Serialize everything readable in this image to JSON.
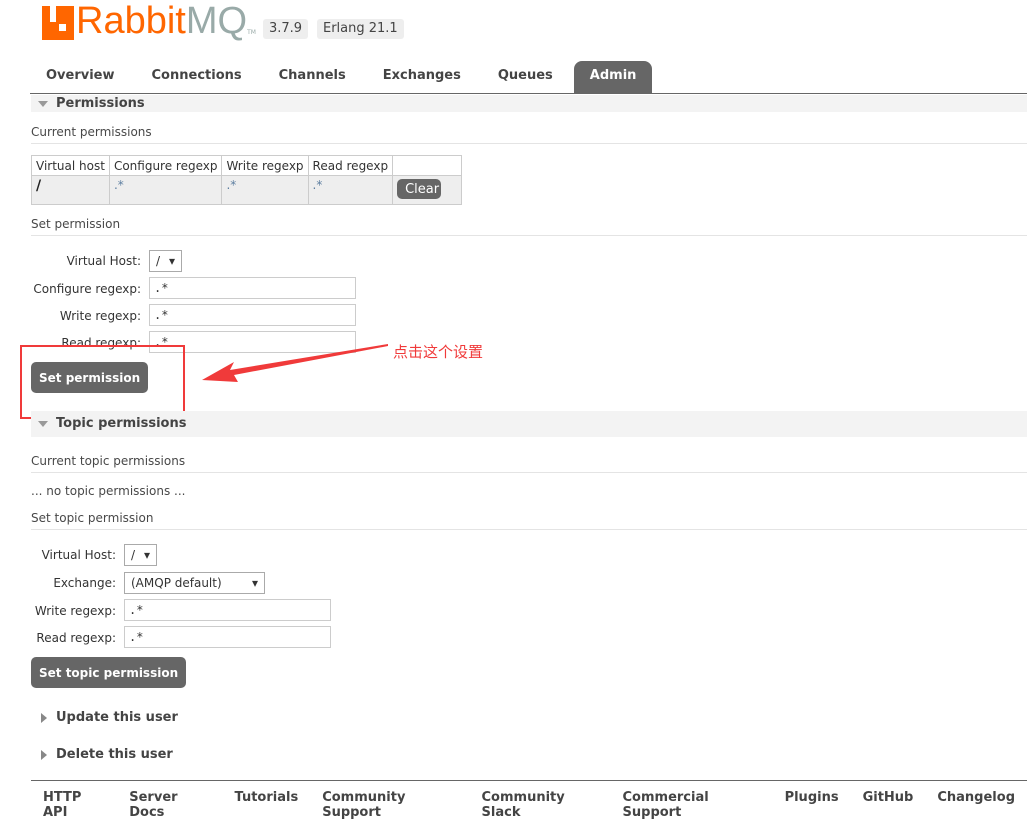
{
  "header": {
    "logo_text_1": "Rabbit",
    "logo_text_2": "MQ",
    "logo_tm": "TM",
    "version": "3.7.9",
    "erlang": "Erlang 21.1"
  },
  "tabs": [
    {
      "label": "Overview"
    },
    {
      "label": "Connections"
    },
    {
      "label": "Channels"
    },
    {
      "label": "Exchanges"
    },
    {
      "label": "Queues"
    },
    {
      "label": "Admin",
      "active": true
    }
  ],
  "permissions": {
    "title": "Permissions",
    "current_title": "Current permissions",
    "columns": [
      "Virtual host",
      "Configure regexp",
      "Write regexp",
      "Read regexp"
    ],
    "rows": [
      {
        "vhost": "/",
        "configure": ".*",
        "write": ".*",
        "read": ".*",
        "action": "Clear"
      }
    ],
    "set_title": "Set permission",
    "form": {
      "vhost_label": "Virtual Host:",
      "vhost_value": "/",
      "configure_label": "Configure regexp:",
      "configure_value": ".*",
      "write_label": "Write regexp:",
      "write_value": ".*",
      "read_label": "Read regexp:",
      "read_value": ".*",
      "submit": "Set permission"
    }
  },
  "annotation": {
    "text": "点击这个设置",
    "color": "#f03a3a"
  },
  "topic": {
    "title": "Topic permissions",
    "current_title": "Current topic permissions",
    "empty": "... no topic permissions ...",
    "set_title": "Set topic permission",
    "form": {
      "vhost_label": "Virtual Host:",
      "vhost_value": "/",
      "exchange_label": "Exchange:",
      "exchange_value": "(AMQP default)",
      "write_label": "Write regexp:",
      "write_value": ".*",
      "read_label": "Read regexp:",
      "read_value": ".*",
      "submit": "Set topic permission"
    }
  },
  "update_user": "Update this user",
  "delete_user": "Delete this user",
  "footer": [
    "HTTP API",
    "Server Docs",
    "Tutorials",
    "Community Support",
    "Community Slack",
    "Commercial Support",
    "Plugins",
    "GitHub",
    "Changelog"
  ]
}
